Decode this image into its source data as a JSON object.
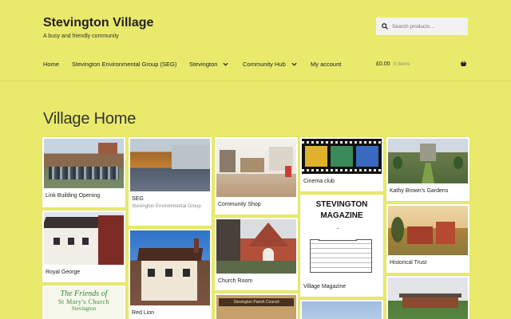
{
  "site": {
    "title": "Stevington Village",
    "tagline": "A busy and friendly community"
  },
  "search": {
    "placeholder": "Search products…"
  },
  "nav": [
    {
      "label": "Home"
    },
    {
      "label": "Stevington Environmental Group (SEG)"
    },
    {
      "label": "Stevington"
    },
    {
      "label": "Community Hub"
    },
    {
      "label": "My account"
    }
  ],
  "cart": {
    "amount": "£0.00",
    "count": "0 items"
  },
  "page": {
    "title": "Village Home"
  },
  "tiles": [
    {
      "label": "Link Building Opening"
    },
    {
      "label": "Royal George"
    },
    {
      "label": "SEG",
      "sub": "Stevington Environmental Group"
    },
    {
      "label": "Red Lion"
    },
    {
      "label": "Community Shop"
    },
    {
      "label": "Church Room"
    },
    {
      "label": "Cinema club"
    },
    {
      "label": "Village Magazine",
      "magazine": "STEVINGTON MAGAZINE"
    },
    {
      "label": "Kathy Brown's Gardens"
    },
    {
      "label": "Historical Trust"
    }
  ],
  "friends_tile": {
    "line1": "The Friends of",
    "line2": "St Mary's Church",
    "line3": "Stevington"
  },
  "parish_tile": {
    "sign": "Stevington Parish Council"
  }
}
